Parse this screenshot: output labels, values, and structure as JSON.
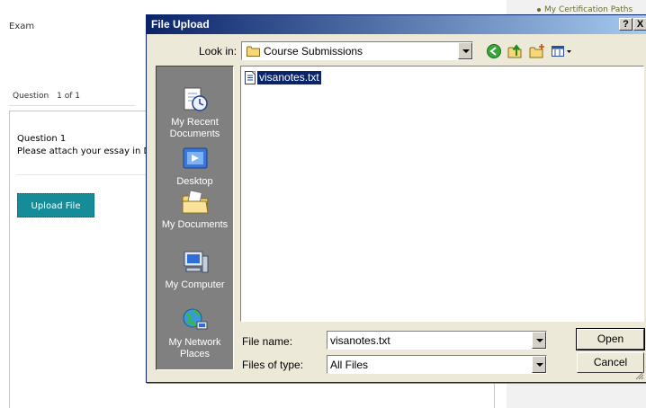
{
  "page": {
    "exam_title": "Exam",
    "question_label": "Question",
    "question_count": "1 of 1",
    "question_heading": "Question 1",
    "question_text": "Please attach your essay in D",
    "upload_button": "Upload File",
    "cert_link": "My Certification Paths"
  },
  "dialog": {
    "title": "File Upload",
    "help_btn": "?",
    "close_btn": "X",
    "look_in_label": "Look in:",
    "look_in_value": "Course Submissions",
    "toolbar_icons": [
      "back-icon",
      "up-folder-icon",
      "new-folder-icon",
      "views-menu-icon"
    ],
    "places": [
      {
        "label": "My Recent Documents",
        "icon": "recent-documents-icon"
      },
      {
        "label": "Desktop",
        "icon": "desktop-icon"
      },
      {
        "label": "My Documents",
        "icon": "my-documents-icon"
      },
      {
        "label": "My Computer",
        "icon": "my-computer-icon"
      },
      {
        "label": "My Network Places",
        "icon": "network-places-icon"
      }
    ],
    "files": [
      {
        "name": "visanotes.txt",
        "icon": "text-file-icon",
        "selected": true
      }
    ],
    "file_name_label": "File name:",
    "file_name_value": "visanotes.txt",
    "files_of_type_label": "Files of type:",
    "files_of_type_value": "All Files",
    "open_button": "Open",
    "cancel_button": "Cancel"
  },
  "colors": {
    "titlebar_start": "#0a246a",
    "titlebar_end": "#a6caf0",
    "dialog_bg": "#ece9d8",
    "places_bg": "#808080",
    "upload_button_bg": "#168c99",
    "selection": "#0a246a"
  }
}
